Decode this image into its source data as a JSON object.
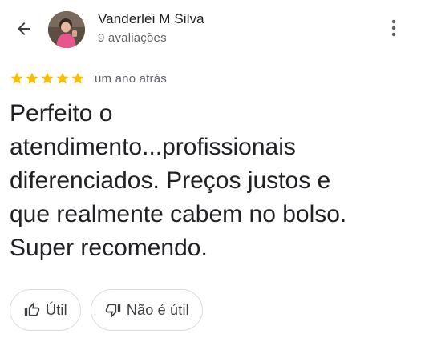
{
  "header": {
    "back_icon": "arrow-back-icon",
    "reviewer_name": "Vanderlei M Silva",
    "review_count": "9 avaliações",
    "menu_icon": "more-vert-icon"
  },
  "review": {
    "rating": 5,
    "rating_max": 5,
    "star_color": "#fbbc04",
    "time_ago": "um ano atrás",
    "text": "Perfeito o\natendimento...profissionais\ndiferenciados. Preços justos e\nque realmente cabem no bolso.\nSuper recomendo."
  },
  "actions": {
    "helpful_label": "Útil",
    "helpful_icon": "thumb-up-icon",
    "not_helpful_label": "Não é útil",
    "not_helpful_icon": "thumb-down-icon"
  }
}
